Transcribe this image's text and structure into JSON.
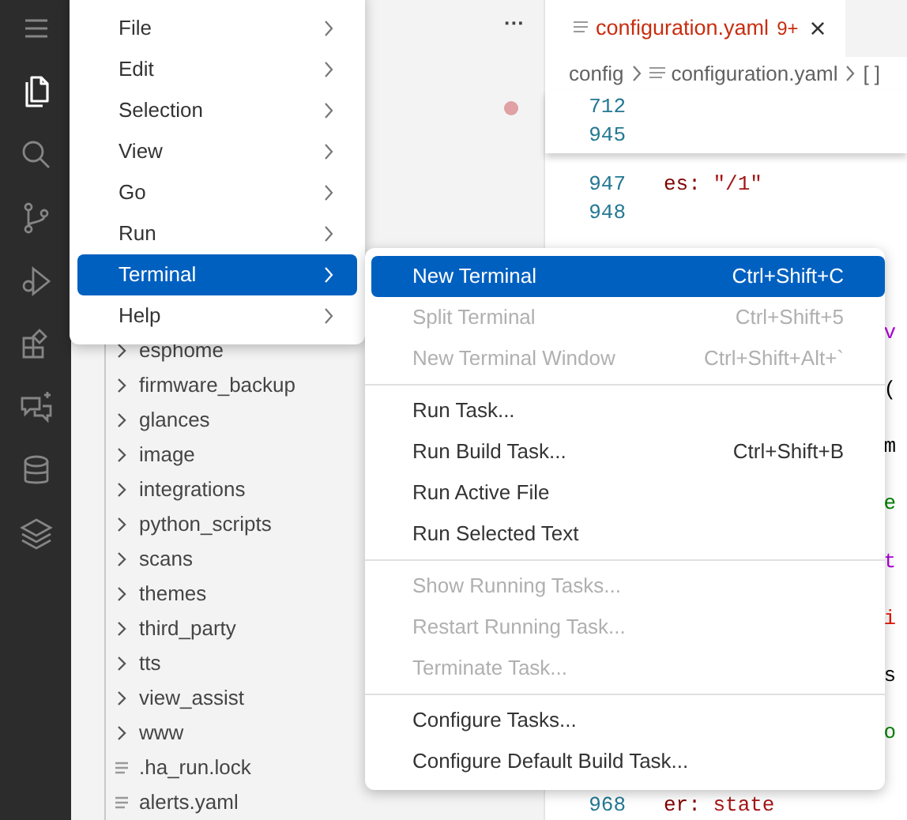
{
  "activity_bar": [
    {
      "kind": "menu",
      "selected": false
    },
    {
      "kind": "files",
      "selected": true
    },
    {
      "kind": "search",
      "selected": false
    },
    {
      "kind": "source-control",
      "selected": false
    },
    {
      "kind": "run-debug",
      "selected": false
    },
    {
      "kind": "extensions",
      "selected": false
    },
    {
      "kind": "chat",
      "selected": false
    },
    {
      "kind": "database",
      "selected": false
    },
    {
      "kind": "layers",
      "selected": false
    }
  ],
  "sidebar": {
    "more": "···",
    "items": [
      {
        "kind": "folder",
        "label": "esphome"
      },
      {
        "kind": "folder",
        "label": "firmware_backup"
      },
      {
        "kind": "folder",
        "label": "glances"
      },
      {
        "kind": "folder",
        "label": "image"
      },
      {
        "kind": "folder",
        "label": "integrations"
      },
      {
        "kind": "folder",
        "label": "python_scripts"
      },
      {
        "kind": "folder",
        "label": "scans"
      },
      {
        "kind": "folder",
        "label": "themes"
      },
      {
        "kind": "folder",
        "label": "third_party"
      },
      {
        "kind": "folder",
        "label": "tts"
      },
      {
        "kind": "folder",
        "label": "view_assist"
      },
      {
        "kind": "folder",
        "label": "www"
      },
      {
        "kind": "file",
        "label": ".ha_run.lock"
      },
      {
        "kind": "file",
        "label": "alerts.yaml"
      }
    ]
  },
  "editor": {
    "tab": {
      "title": "configuration.yaml",
      "badge": "9+",
      "close": "×"
    },
    "breadcrumb": [
      "config",
      "configuration.yaml",
      "[ ]"
    ],
    "sticky_lines": [
      {
        "number": "712"
      },
      {
        "number": "945"
      }
    ],
    "lines": [
      {
        "number": "947",
        "key": "es:",
        "value": "\"/1\""
      },
      {
        "number": "948"
      },
      {
        "fragment": "v",
        "color": "#af00db"
      },
      {
        "fragment": "(",
        "color": "#000000"
      },
      {
        "fragment": "m",
        "color": "#000000"
      },
      {
        "fragment": "e",
        "color": "#008000"
      },
      {
        "fragment": "t",
        "color": "#af00db"
      },
      {
        "fragment": "i",
        "color": "#e51400"
      },
      {
        "fragment": "s",
        "color": "#000000"
      },
      {
        "fragment": "o",
        "color": "#008000"
      },
      {
        "number": "968",
        "key": "er:",
        "value": "state"
      }
    ]
  },
  "menu": [
    {
      "label": "File",
      "selected": false
    },
    {
      "label": "Edit",
      "selected": false
    },
    {
      "label": "Selection",
      "selected": false
    },
    {
      "label": "View",
      "selected": false
    },
    {
      "label": "Go",
      "selected": false
    },
    {
      "label": "Run",
      "selected": false
    },
    {
      "label": "Terminal",
      "selected": true
    },
    {
      "label": "Help",
      "selected": false
    }
  ],
  "submenu": [
    {
      "kind": "item",
      "label": "New Terminal",
      "shortcut": "Ctrl+Shift+C",
      "selected": true,
      "disabled": false
    },
    {
      "kind": "item",
      "label": "Split Terminal",
      "shortcut": "Ctrl+Shift+5",
      "selected": false,
      "disabled": true
    },
    {
      "kind": "item",
      "label": "New Terminal Window",
      "shortcut": "Ctrl+Shift+Alt+`",
      "selected": false,
      "disabled": true
    },
    {
      "kind": "separator"
    },
    {
      "kind": "item",
      "label": "Run Task...",
      "selected": false,
      "disabled": false
    },
    {
      "kind": "item",
      "label": "Run Build Task...",
      "shortcut": "Ctrl+Shift+B",
      "selected": false,
      "disabled": false
    },
    {
      "kind": "item",
      "label": "Run Active File",
      "selected": false,
      "disabled": false
    },
    {
      "kind": "item",
      "label": "Run Selected Text",
      "selected": false,
      "disabled": false
    },
    {
      "kind": "separator"
    },
    {
      "kind": "item",
      "label": "Show Running Tasks...",
      "selected": false,
      "disabled": true
    },
    {
      "kind": "item",
      "label": "Restart Running Task...",
      "selected": false,
      "disabled": true
    },
    {
      "kind": "item",
      "label": "Terminate Task...",
      "selected": false,
      "disabled": true
    },
    {
      "kind": "separator"
    },
    {
      "kind": "item",
      "label": "Configure Tasks...",
      "selected": false,
      "disabled": false
    },
    {
      "kind": "item",
      "label": "Configure Default Build Task...",
      "selected": false,
      "disabled": false
    }
  ]
}
